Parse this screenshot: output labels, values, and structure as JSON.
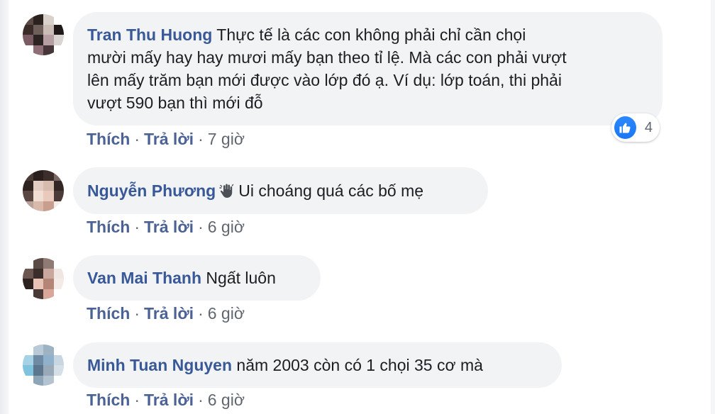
{
  "comments": [
    {
      "author": "Tran Thu Huong",
      "text_lines": [
        "Thực tế là các con không phải chỉ cần chọi",
        "mười mấy hay hay mươi mấy bạn theo tỉ lệ. Mà các con phải vượt",
        "lên mấy trăm bạn mới được vào lớp đó ạ. Ví dụ: lớp toán, thi phải",
        "vượt 590 bạn thì mới đỗ"
      ],
      "like_label": "Thích",
      "reply_label": "Trả lời",
      "time": "7 giờ",
      "reaction_count": "4"
    },
    {
      "author": "Nguyễn Phương",
      "text": "Ui choáng quá các bố mẹ",
      "like_label": "Thích",
      "reply_label": "Trả lời",
      "time": "6 giờ"
    },
    {
      "author": "Van Mai Thanh",
      "text": "Ngất luôn",
      "like_label": "Thích",
      "reply_label": "Trả lời",
      "time": "6 giờ"
    },
    {
      "author": "Minh Tuan Nguyen",
      "text": "năm 2003 còn có 1 chọi 35 cơ mà",
      "like_label": "Thích",
      "reply_label": "Trả lời",
      "time": "6 giờ"
    }
  ],
  "separator": "·",
  "colors": {
    "author": "#385898",
    "bubble": "#f2f3f5",
    "like_reaction": "#1877f2",
    "meta": "#606770"
  },
  "icons": {
    "reaction": "thumbs-up-icon",
    "badge": "waving-hand-icon"
  }
}
